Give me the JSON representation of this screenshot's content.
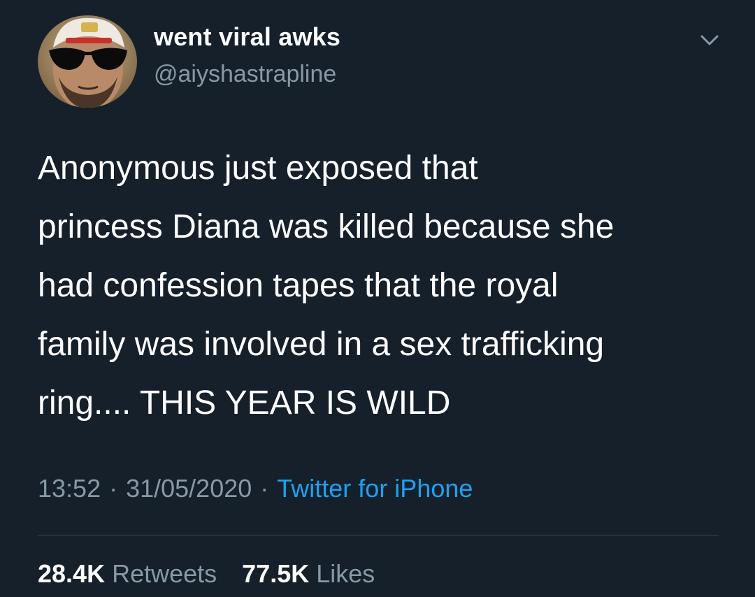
{
  "user": {
    "display_name": "went viral awks",
    "handle": "@aiyshastrapline",
    "avatar_icon": "profile-photo-sunglasses-cap"
  },
  "menu_icon": "chevron-down-icon",
  "tweet": {
    "text": "Anonymous just exposed that\nprincess Diana was killed because she\nhad confession tapes that the royal\nfamily was involved in a sex trafficking\nring.... THIS YEAR IS WILD"
  },
  "meta": {
    "time": "13:52",
    "separator": "·",
    "date": "31/05/2020",
    "source": "Twitter for iPhone"
  },
  "stats": {
    "retweets_count": "28.4K",
    "retweets_label": "Retweets",
    "likes_count": "77.5K",
    "likes_label": "Likes"
  },
  "colors": {
    "background": "#15202b",
    "text_primary": "#ffffff",
    "text_secondary": "#8899a6",
    "link": "#1da1f2",
    "divider": "#38444d"
  }
}
